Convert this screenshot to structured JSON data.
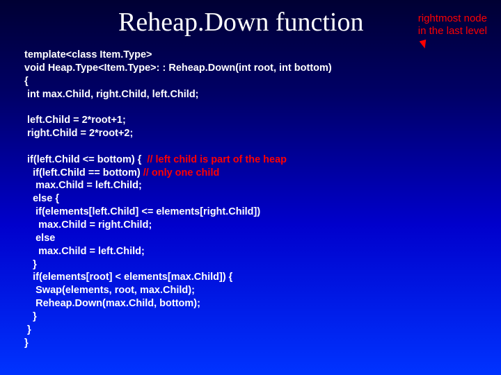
{
  "title": "Reheap.Down function",
  "annotation": {
    "line1": "rightmost node",
    "line2": "in the last level"
  },
  "code": {
    "l1": "template<class Item.Type>",
    "l2": "void Heap.Type<Item.Type>: : Reheap.Down(int root, int bottom)",
    "l3": "{",
    "l4": " int max.Child, right.Child, left.Child;",
    "l5": "",
    "l6": " left.Child = 2*root+1;",
    "l7": " right.Child = 2*root+2;",
    "l8": "",
    "l9a": " if(left.Child <= bottom) {  ",
    "l9c": "// left child is part of the heap",
    "l10a": "   if(left.Child == bottom) ",
    "l10c": "// only one child",
    "l11": "    max.Child = left.Child;",
    "l12": "   else {",
    "l13": "    if(elements[left.Child] <= elements[right.Child])",
    "l14": "     max.Child = right.Child;",
    "l15": "    else",
    "l16": "     max.Child = left.Child;",
    "l17": "   }",
    "l18": "   if(elements[root] < elements[max.Child]) {",
    "l19": "    Swap(elements, root, max.Child);",
    "l20": "    Reheap.Down(max.Child, bottom);",
    "l21": "   }",
    "l22": " }",
    "l23": "}"
  }
}
